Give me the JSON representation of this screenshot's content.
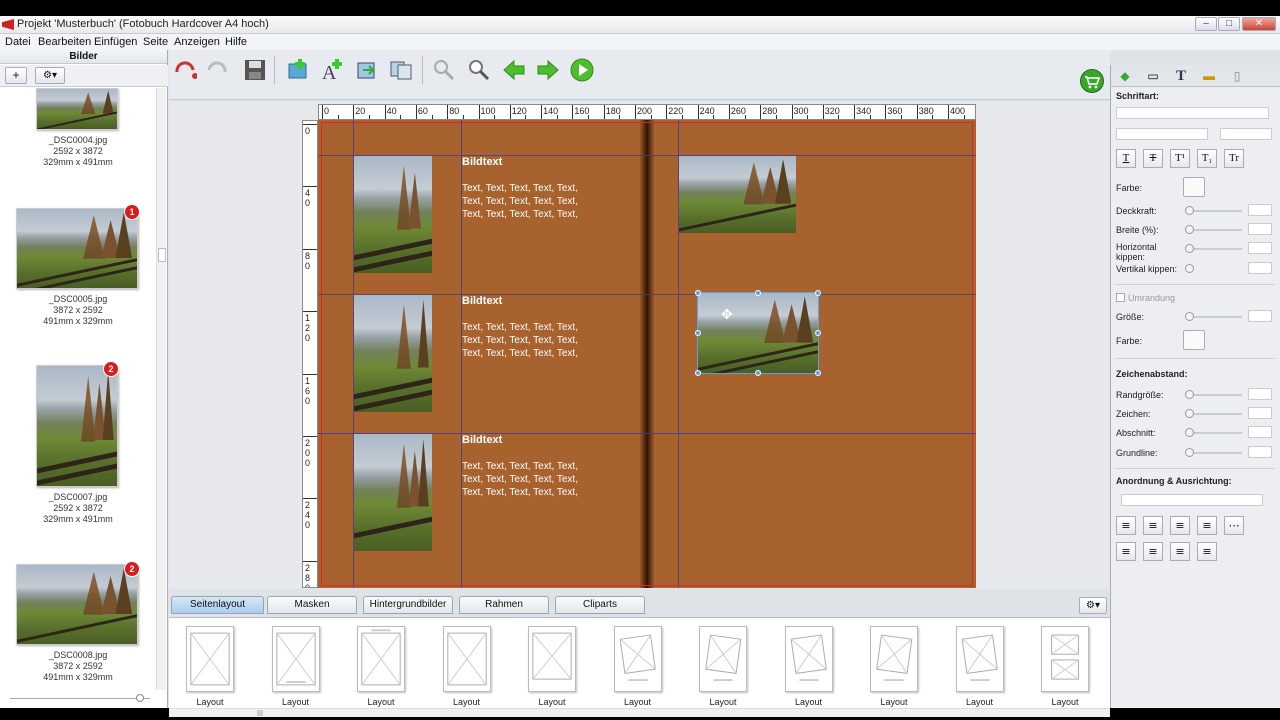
{
  "window": {
    "title": "Projekt 'Musterbuch' (Fotobuch Hardcover A4 hoch)"
  },
  "menu": [
    "Datei",
    "Bearbeiten",
    "Einfügen",
    "Seite",
    "Anzeigen",
    "Hilfe"
  ],
  "left_panel": {
    "title": "Bilder",
    "add_label": "+",
    "gear_label": "⚙▾",
    "images": [
      {
        "name": "_DSC0004.jpg",
        "pixels": "2592 x 3872",
        "size": "329mm x 491mm",
        "badge": ""
      },
      {
        "name": "_DSC0005.jpg",
        "pixels": "3872 x 2592",
        "size": "491mm x 329mm",
        "badge": "1"
      },
      {
        "name": "_DSC0007.jpg",
        "pixels": "2592 x 3872",
        "size": "329mm x 491mm",
        "badge": "2"
      },
      {
        "name": "_DSC0008.jpg",
        "pixels": "3872 x 2592",
        "size": "491mm x 329mm",
        "badge": "2"
      }
    ]
  },
  "ruler": {
    "h_ticks": [
      "0",
      "20",
      "40",
      "60",
      "80",
      "100",
      "120",
      "140",
      "160",
      "180",
      "200",
      "220",
      "240",
      "260",
      "280",
      "300",
      "320",
      "340",
      "360",
      "380",
      "400"
    ],
    "v_ticks": [
      "0",
      "4\n0",
      "8\n0",
      "1\n2\n0",
      "1\n6\n0",
      "2\n0\n0",
      "2\n4\n0",
      "2\n8\n0"
    ]
  },
  "page": {
    "rows": [
      {
        "heading": "Bildtext",
        "lines": [
          "Text, Text, Text, Text, Text,",
          "Text, Text, Text, Text, Text,",
          "Text, Text, Text, Text, Text,"
        ]
      },
      {
        "heading": "Bildtext",
        "lines": [
          "Text, Text, Text, Text, Text,",
          "Text, Text, Text, Text, Text,",
          "Text, Text, Text, Text, Text,"
        ]
      },
      {
        "heading": "Bildtext",
        "lines": [
          "Text, Text, Text, Text, Text,",
          "Text, Text, Text, Text, Text,",
          "Text, Text, Text, Text, Text,"
        ]
      }
    ]
  },
  "bottom_tabs": [
    "Seitenlayout",
    "Masken",
    "Hintergrundbilder",
    "Rahmen",
    "Cliparts"
  ],
  "layouts": [
    "Layout",
    "Layout",
    "Layout",
    "Layout",
    "Layout",
    "Layout",
    "Layout",
    "Layout",
    "Layout",
    "Layout",
    "Layout"
  ],
  "right_panel": {
    "schriftart": "Schriftart:",
    "farbe": "Farbe:",
    "deckkraft": "Deckkraft:",
    "breite": "Breite (%):",
    "h_kippen": "Horizontal kippen:",
    "v_kippen": "Vertikal kippen:",
    "umrandung": "Umrandung",
    "groesse": "Größe:",
    "farbe2": "Farbe:",
    "zeichenabstand": "Zeichenabstand:",
    "randgroesse": "Randgröße:",
    "zeichen": "Zeichen:",
    "abschnitt": "Abschnitt:",
    "grundline": "Grundline:",
    "anordnung": "Anordnung & Ausrichtung:",
    "fmt_buttons": [
      "T",
      "T",
      "T¹",
      "T₁",
      "Tr"
    ]
  }
}
